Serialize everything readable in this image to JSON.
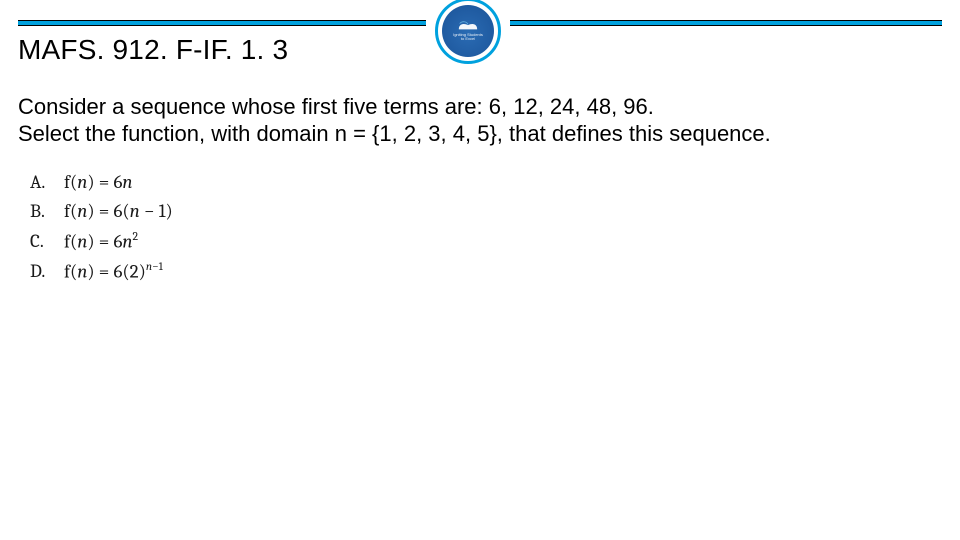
{
  "standard_code": "MAFS. 912. F-IF. 1. 3",
  "logo": {
    "alt": "district-seal",
    "line1": "Igniting Students",
    "line2": "to Excel"
  },
  "problem": {
    "line1": "Consider a sequence whose first five terms are: 6, 12, 24, 48, 96.",
    "line2": "Select the function, with domain n = {1, 2, 3, 4, 5}, that defines this sequence."
  },
  "choices": [
    {
      "label": "A.",
      "expr_html": "<span class='rm'>f(</span>n<span class='rm'>) = 6</span>n"
    },
    {
      "label": "B.",
      "expr_html": "<span class='rm'>f(</span>n<span class='rm'>) = 6(</span>n <span class='rm'>− 1)</span>"
    },
    {
      "label": "C.",
      "expr_html": "<span class='rm'>f(</span>n<span class='rm'>) = 6</span>n<sup><span class='rm'>2</span></sup>"
    },
    {
      "label": "D.",
      "expr_html": "<span class='rm'>f(</span>n<span class='rm'>) = 6(2)</span><sup>n<span class='rm'>−1</span></sup>"
    }
  ]
}
